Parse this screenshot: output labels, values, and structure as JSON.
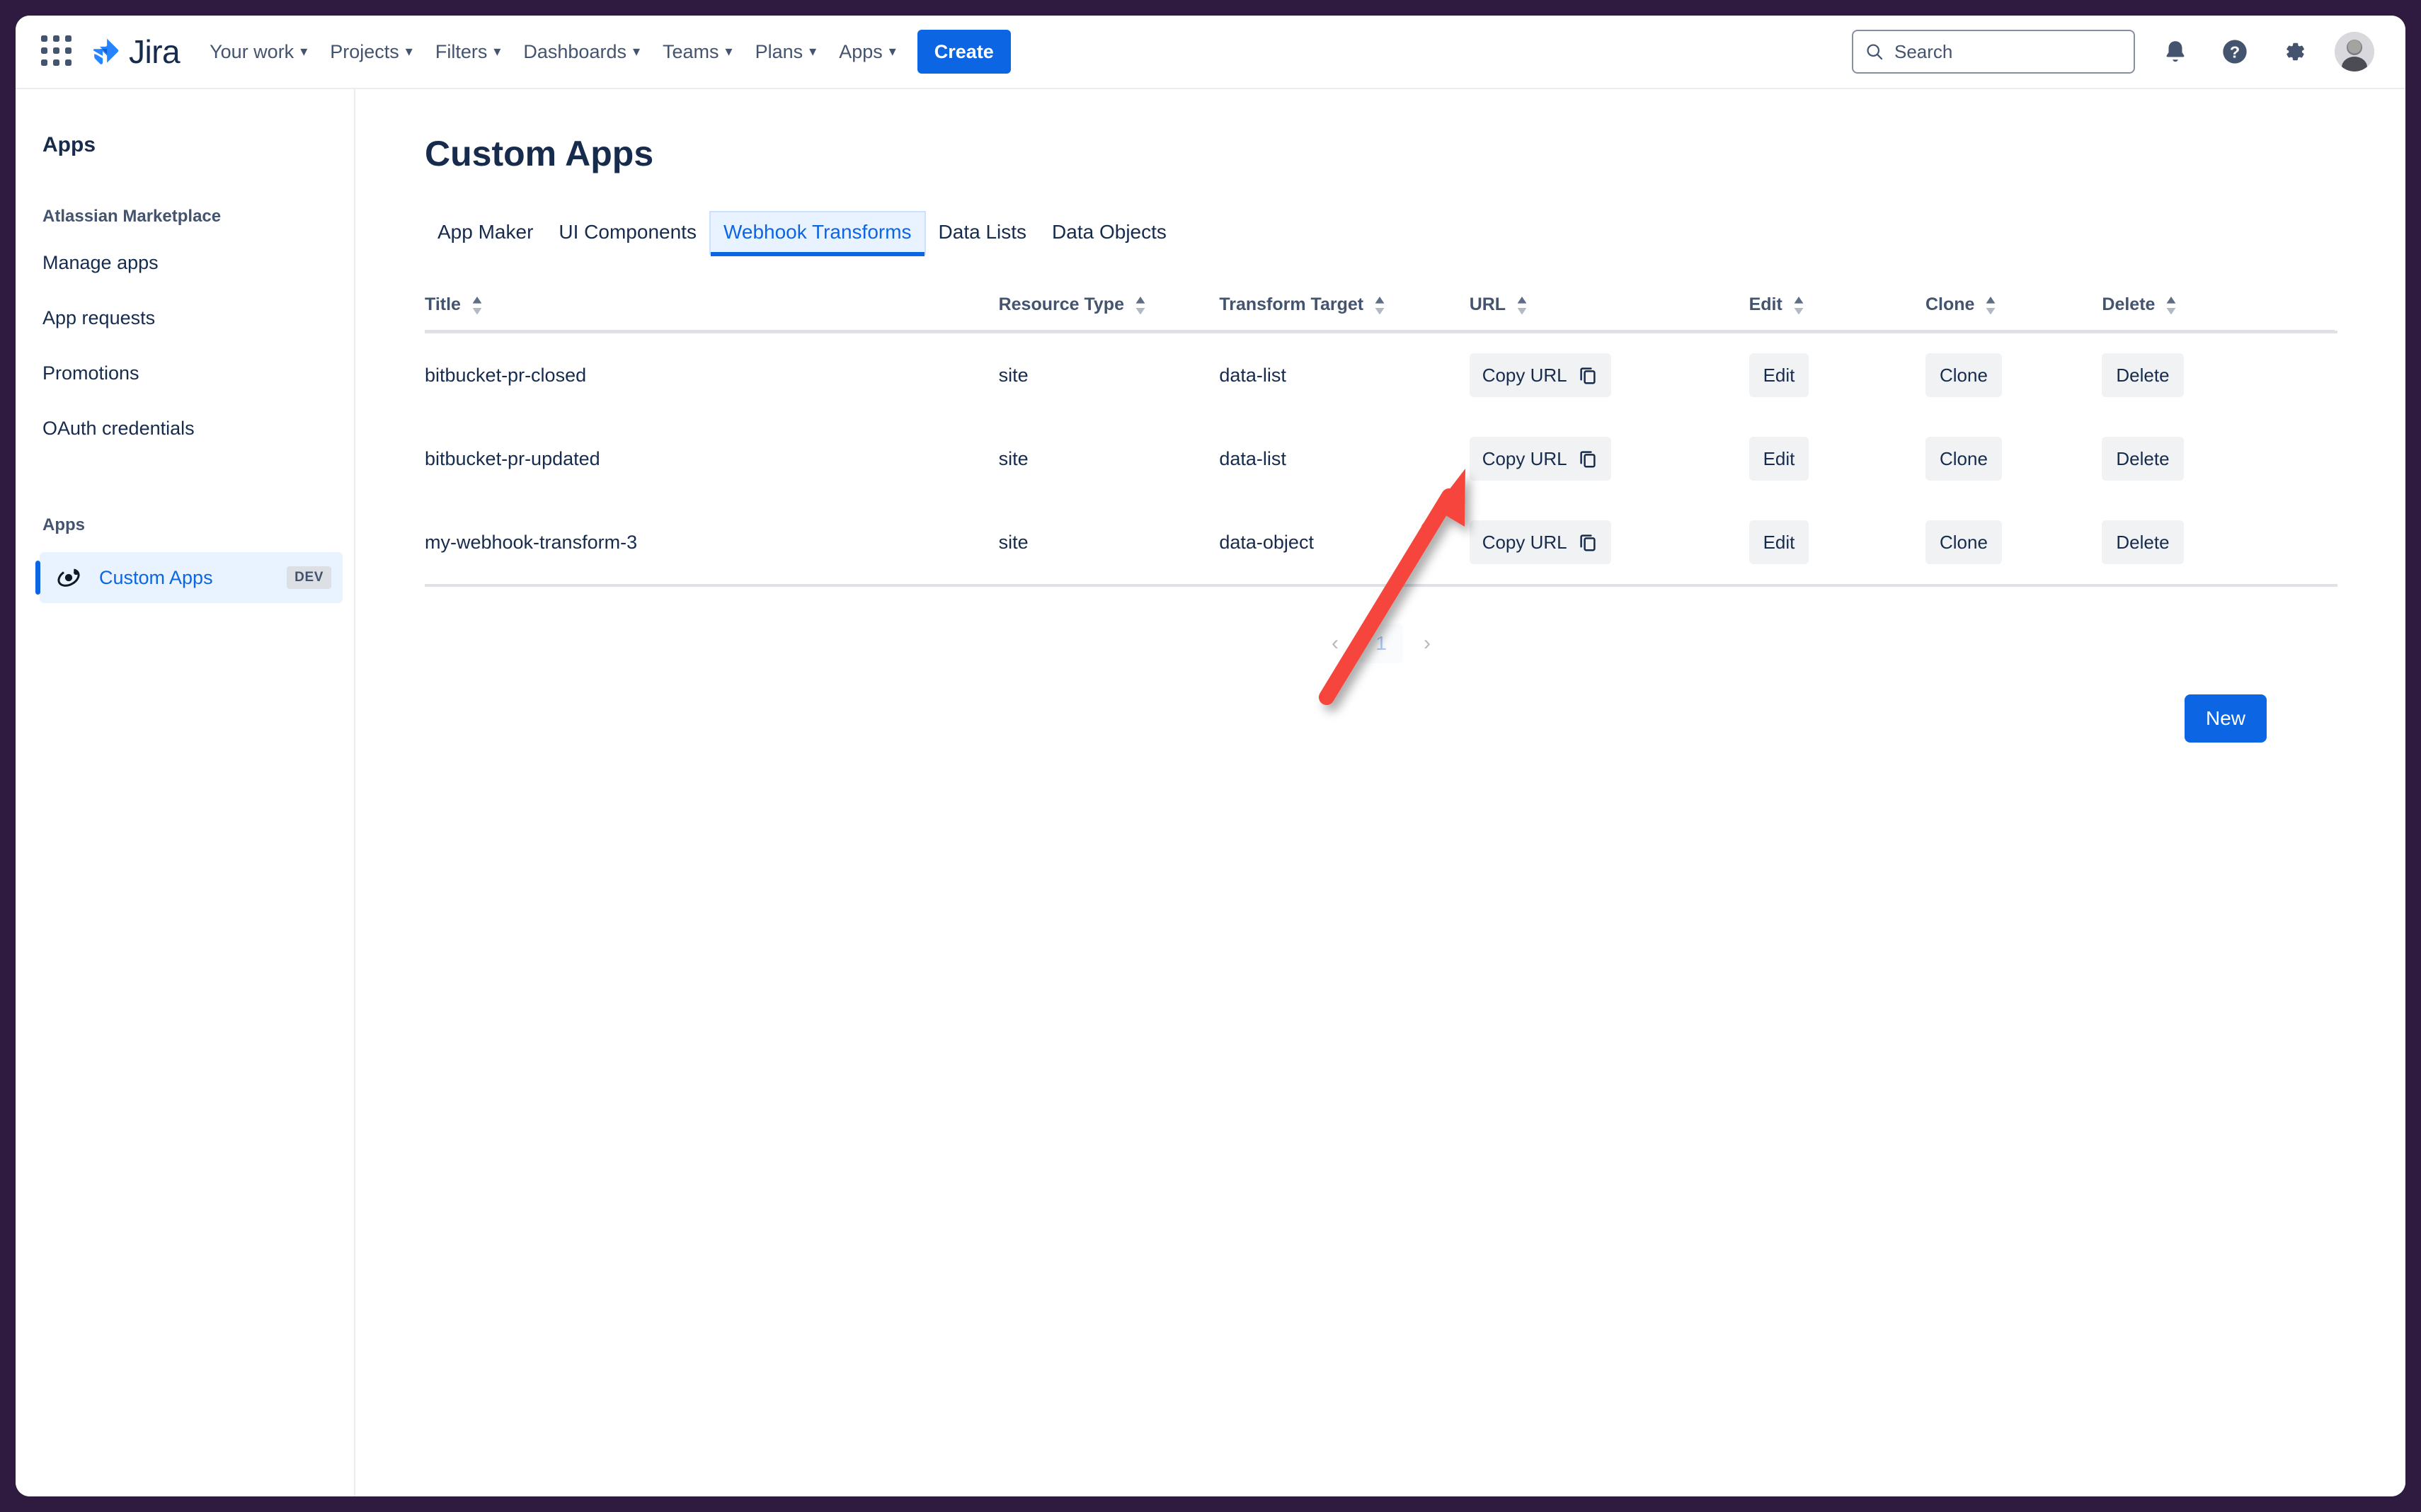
{
  "nav": {
    "apps_grid_icon": "apps-grid-icon",
    "brand": "Jira",
    "items": [
      {
        "label": "Your work",
        "has_chevron": true
      },
      {
        "label": "Projects",
        "has_chevron": true
      },
      {
        "label": "Filters",
        "has_chevron": true
      },
      {
        "label": "Dashboards",
        "has_chevron": true
      },
      {
        "label": "Teams",
        "has_chevron": true
      },
      {
        "label": "Plans",
        "has_chevron": true
      },
      {
        "label": "Apps",
        "has_chevron": true
      }
    ],
    "create_label": "Create",
    "search_placeholder": "Search",
    "icons": [
      "notifications-icon",
      "help-icon",
      "settings-icon",
      "avatar"
    ]
  },
  "sidebar": {
    "title": "Apps",
    "section_label": "Atlassian Marketplace",
    "items": [
      {
        "label": "Manage apps"
      },
      {
        "label": "App requests"
      },
      {
        "label": "Promotions"
      },
      {
        "label": "OAuth credentials"
      }
    ],
    "group_title": "Apps",
    "selected": {
      "label": "Custom Apps",
      "badge": "DEV",
      "icon": "atom-orbit-icon"
    }
  },
  "main": {
    "page_title": "Custom Apps",
    "tabs": [
      {
        "label": "App Maker",
        "active": false
      },
      {
        "label": "UI Components",
        "active": false
      },
      {
        "label": "Webhook Transforms",
        "active": true
      },
      {
        "label": "Data Lists",
        "active": false
      },
      {
        "label": "Data Objects",
        "active": false
      }
    ],
    "table": {
      "columns": [
        "Title",
        "Resource Type",
        "Transform Target",
        "URL",
        "Edit",
        "Clone",
        "Delete"
      ],
      "rows": [
        {
          "title": "bitbucket-pr-closed",
          "resource_type": "site",
          "transform_target": "data-list",
          "url_label": "Copy URL",
          "edit_label": "Edit",
          "clone_label": "Clone",
          "delete_label": "Delete"
        },
        {
          "title": "bitbucket-pr-updated",
          "resource_type": "site",
          "transform_target": "data-list",
          "url_label": "Copy URL",
          "edit_label": "Edit",
          "clone_label": "Clone",
          "delete_label": "Delete"
        },
        {
          "title": "my-webhook-transform-3",
          "resource_type": "site",
          "transform_target": "data-object",
          "url_label": "Copy URL",
          "edit_label": "Edit",
          "clone_label": "Clone",
          "delete_label": "Delete"
        }
      ]
    },
    "pagination": {
      "prev": "‹",
      "page": "1",
      "next": "›"
    },
    "new_label": "New"
  },
  "annotation": {
    "type": "arrow",
    "color": "#F5453C",
    "points_to": "copy-url-button-row-3"
  },
  "colors": {
    "brand_blue": "#0C66E4",
    "frame_purple": "#2E1B3F",
    "text_dark": "#172B4D",
    "text_muted": "#44546F",
    "button_grey": "#F1F2F4",
    "tab_active_bg": "#E9F2FF",
    "annotation_red": "#F5453C"
  }
}
